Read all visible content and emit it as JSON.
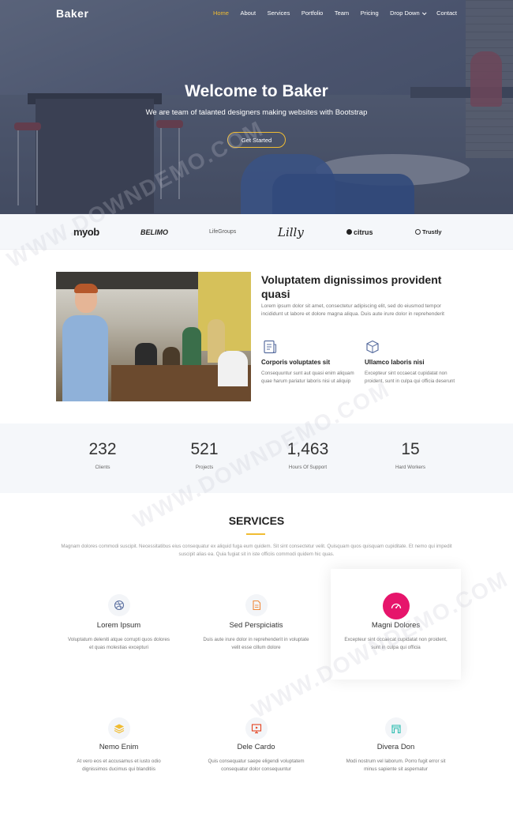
{
  "nav": {
    "brand": "Baker",
    "items": [
      {
        "label": "Home",
        "active": true
      },
      {
        "label": "About"
      },
      {
        "label": "Services"
      },
      {
        "label": "Portfolio"
      },
      {
        "label": "Team"
      },
      {
        "label": "Pricing"
      },
      {
        "label": "Drop Down",
        "dropdown": true
      },
      {
        "label": "Contact"
      }
    ]
  },
  "hero": {
    "title": "Welcome to Baker",
    "subtitle": "We are team of talanted designers making websites with Bootstrap",
    "cta_label": "Get Started"
  },
  "clients": [
    "myob",
    "BELIMO",
    "LifeGroups",
    "Lilly",
    "citrus",
    "Trustly"
  ],
  "about": {
    "title": "Voluptatem dignissimos provident quasi",
    "desc": "Lorem ipsum dolor sit amet, consectetur adipiscing elit, sed do eiusmod tempor incididunt ut labore et dolore magna aliqua. Duis aute irure dolor in reprehenderit",
    "features": [
      {
        "icon": "receipt-icon",
        "title": "Corporis voluptates sit",
        "desc": "Consequuntur sunt aut quasi enim aliquam quae harum pariatur laboris nisi ut aliquip"
      },
      {
        "icon": "cube-icon",
        "title": "Ullamco laboris nisi",
        "desc": "Excepteur sint occaecat cupidatat non proident, sunt in culpa qui officia deserunt"
      }
    ]
  },
  "counts": [
    {
      "value": "232",
      "label": "Clients"
    },
    {
      "value": "521",
      "label": "Projects"
    },
    {
      "value": "1,463",
      "label": "Hours Of Support"
    },
    {
      "value": "15",
      "label": "Hard Workers"
    }
  ],
  "services": {
    "title": "SERVICES",
    "desc": "Magnam dolores commodi suscipit. Necessitatibus eius consequatur ex aliquid fuga eum quidem. Sit sint consectetur velit. Quisquam quos quisquam cupiditate. Et nemo qui impedit suscipit alias ea. Quia fugiat sit in iste officiis commodi quidem hic quas.",
    "cards": [
      {
        "icon": "dribbble-icon",
        "title": "Lorem Ipsum",
        "desc": "Voluptatum deleniti atque corrupti quos dolores et quas molestias excepturi"
      },
      {
        "icon": "document-icon",
        "title": "Sed Perspiciatis",
        "desc": "Duis aute irure dolor in reprehenderit in voluptate velit esse cillum dolore"
      },
      {
        "icon": "speedometer-icon",
        "title": "Magni Dolores",
        "desc": "Excepteur sint occaecat cupidatat non proident, sunt in culpa qui officia"
      },
      {
        "icon": "layers-icon",
        "title": "Nemo Enim",
        "desc": "At vero eos et accusamus et iusto odio dignissimos ducimus qui blanditiis"
      },
      {
        "icon": "slideshow-icon",
        "title": "Dele Cardo",
        "desc": "Quis consequatur saepe eligendi voluptatem consequatur dolor consequuntur"
      },
      {
        "icon": "arch-icon",
        "title": "Divera Don",
        "desc": "Modi nostrum vel laborum. Porro fugit error sit minus sapiente sit aspernatur"
      }
    ]
  },
  "watermark": "WWW.DOWNDEMO.COM",
  "colors": {
    "accent": "#f0bc32",
    "pink": "#e6156b",
    "text": "#222222",
    "muted": "#777777"
  }
}
